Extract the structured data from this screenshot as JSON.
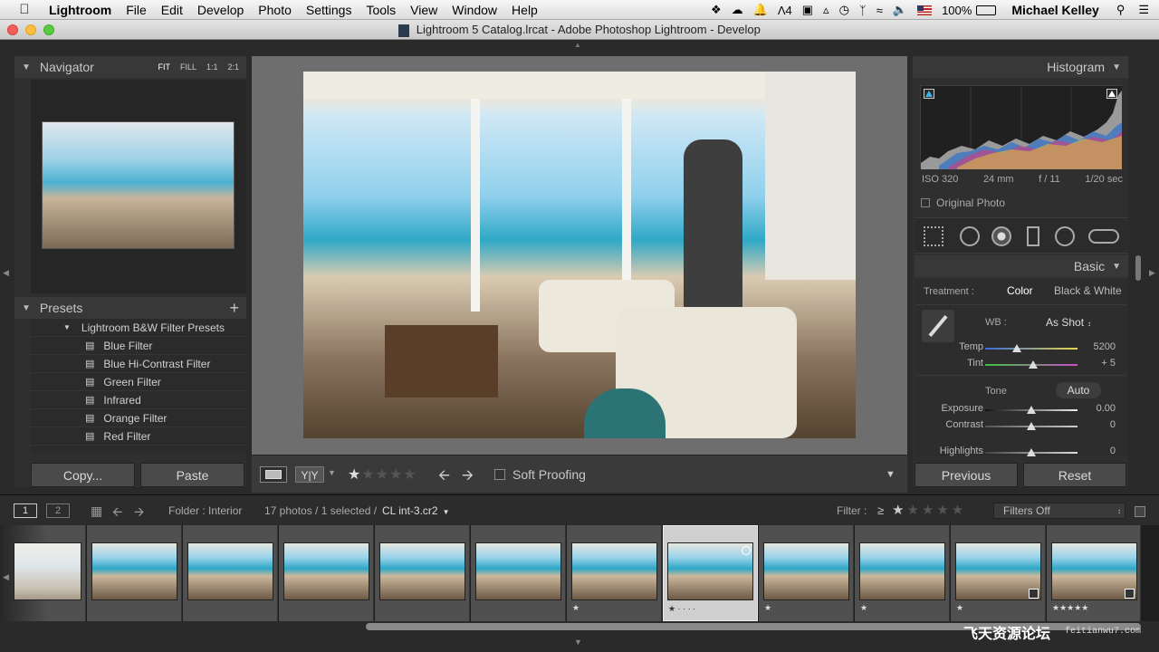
{
  "menubar": {
    "app": "Lightroom",
    "items": [
      "File",
      "Edit",
      "Develop",
      "Photo",
      "Settings",
      "Tools",
      "View",
      "Window",
      "Help"
    ],
    "status_badge": "4",
    "battery": "100%",
    "user": "Michael Kelley"
  },
  "window": {
    "title": "Lightroom 5 Catalog.lrcat - Adobe Photoshop Lightroom - Develop"
  },
  "navigator": {
    "title": "Navigator",
    "zoom": [
      "FIT",
      "FILL",
      "1:1",
      "2:1"
    ]
  },
  "presets": {
    "title": "Presets",
    "add": "+",
    "folder": "Lightroom B&W Filter Presets",
    "items": [
      "Blue Filter",
      "Blue Hi-Contrast Filter",
      "Green Filter",
      "Infrared",
      "Orange Filter",
      "Red Filter"
    ]
  },
  "left_buttons": {
    "copy": "Copy...",
    "paste": "Paste"
  },
  "toolbar": {
    "soft_proofing": "Soft Proofing",
    "yy": "Y|Y"
  },
  "histogram": {
    "title": "Histogram",
    "iso": "ISO 320",
    "focal": "24 mm",
    "aperture": "f / 11",
    "shutter": "1/20 sec",
    "original_photo": "Original Photo"
  },
  "basic": {
    "title": "Basic",
    "treatment_label": "Treatment :",
    "color": "Color",
    "bw": "Black & White",
    "wb_label": "WB :",
    "wb_value": "As Shot",
    "temp_label": "Temp",
    "temp_value": "5200",
    "tint_label": "Tint",
    "tint_value": "+ 5",
    "tone_label": "Tone",
    "auto": "Auto",
    "exposure_label": "Exposure",
    "exposure_value": "0.00",
    "contrast_label": "Contrast",
    "contrast_value": "0",
    "highlights_label": "Highlights",
    "highlights_value": "0"
  },
  "right_buttons": {
    "previous": "Previous",
    "reset": "Reset"
  },
  "filmbar": {
    "page1": "1",
    "page2": "2",
    "folder": "Folder : Interior",
    "count": "17 photos / 1 selected /",
    "file": "CL int-3.cr2",
    "filter_label": "Filter :",
    "filter_op": "≥",
    "filters_off": "Filters Off"
  },
  "filmstrip": {
    "thumbs": [
      {
        "stars": ""
      },
      {
        "stars": ""
      },
      {
        "stars": ""
      },
      {
        "stars": ""
      },
      {
        "stars": ""
      },
      {
        "stars": ""
      },
      {
        "stars": "★"
      },
      {
        "stars": "★ · · · ·"
      },
      {
        "stars": "★"
      },
      {
        "stars": "★"
      },
      {
        "stars": "★"
      },
      {
        "stars": "★★★★★"
      }
    ]
  },
  "watermark": {
    "text": "飞天资源论坛",
    "url": "feitianwu7.com"
  }
}
